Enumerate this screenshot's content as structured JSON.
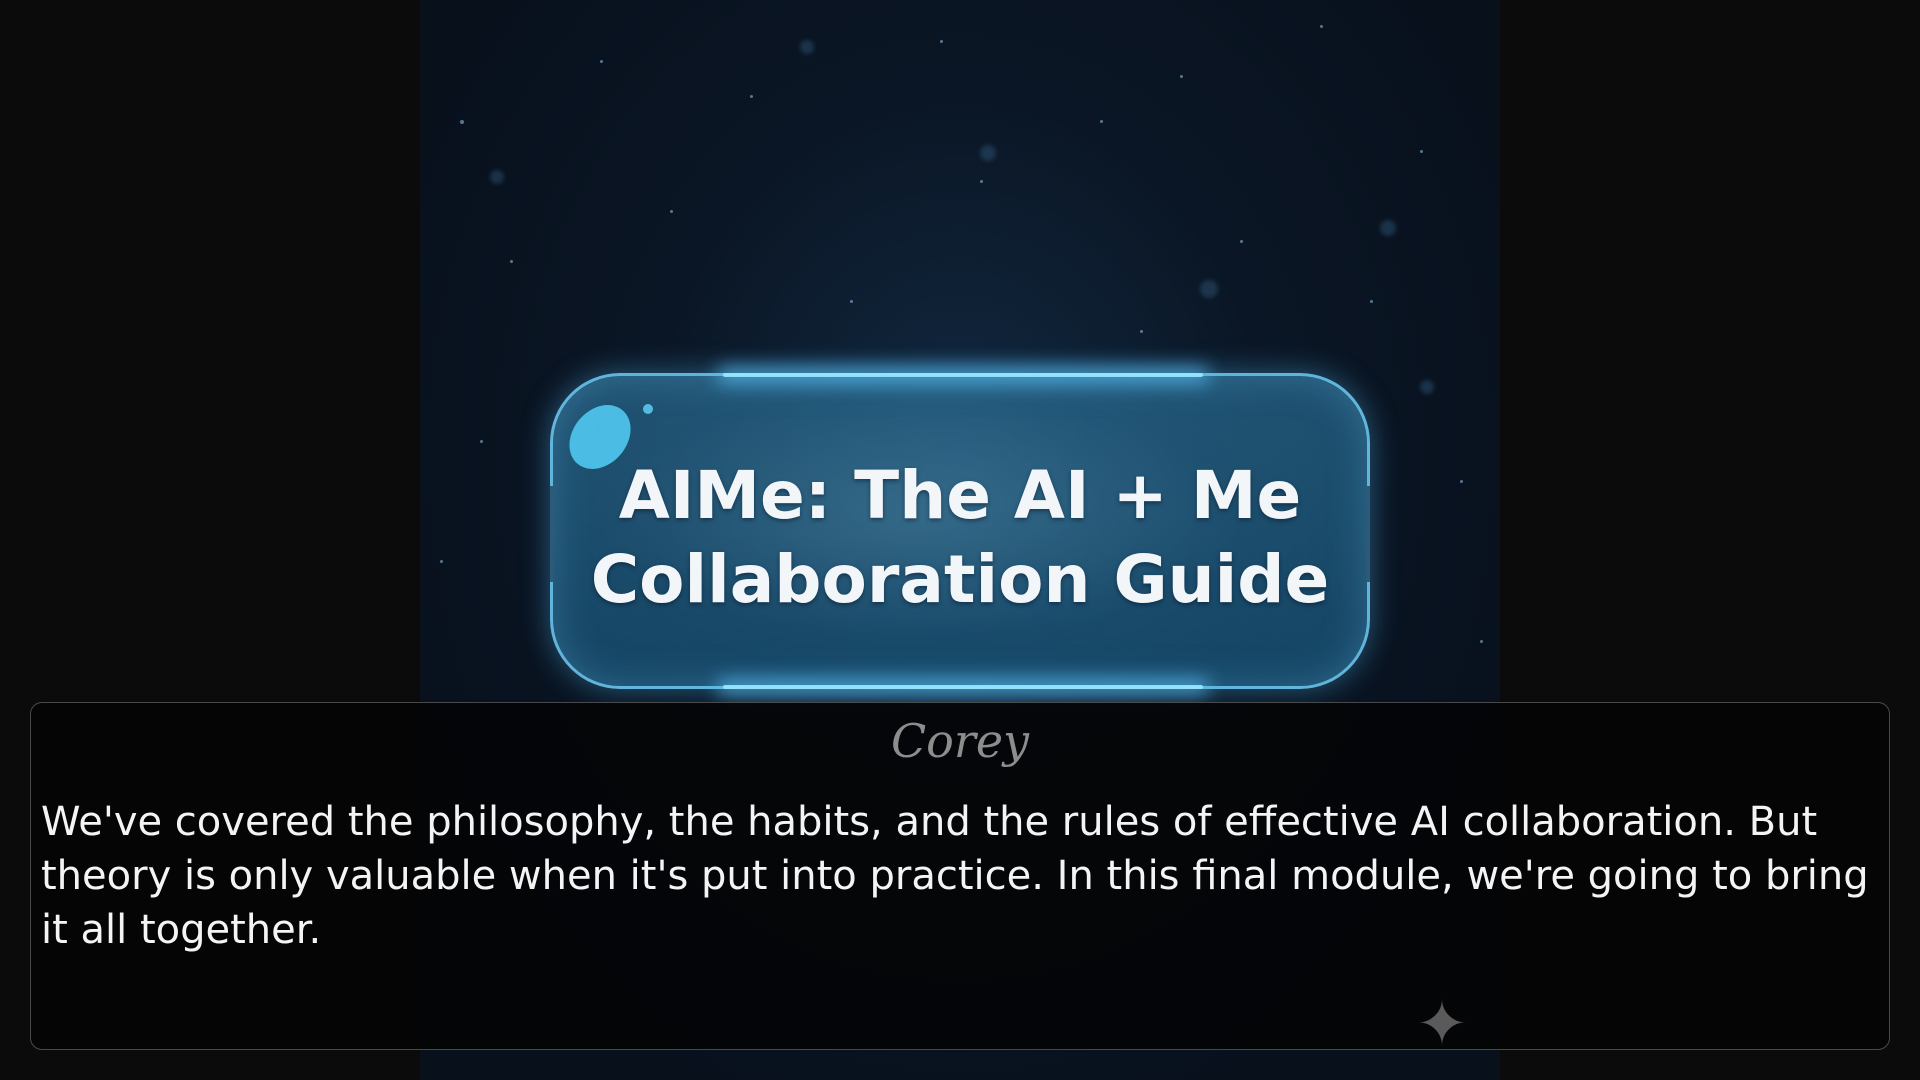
{
  "title_card": {
    "line1": "AIMe: The AI + Me",
    "line2": "Collaboration Guide"
  },
  "dialog": {
    "speaker": "Corey",
    "text": "We've covered the philosophy, the habits, and the rules of effective AI collaboration. But theory is only valuable when it's put into practice. In this final module, we're going to bring it all together.",
    "advance_icon": "sparkle-icon"
  },
  "colors": {
    "page_background": "#0b0b0c",
    "scene_background": "#08111c",
    "title_card_border": "#6ec8f0",
    "title_text": "#f2f6f8",
    "speaker_text": "#8d8d8d",
    "dialog_text": "#f4f4f4"
  }
}
